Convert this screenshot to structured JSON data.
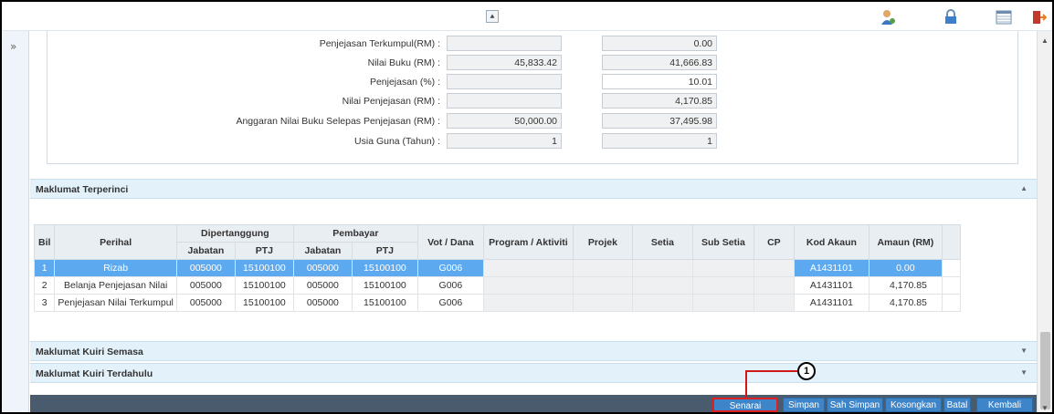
{
  "toolbar_top": {
    "collapse_glyph": "«",
    "icons": [
      "user-settings-icon",
      "lock-icon",
      "table-view-icon",
      "exit-door-icon"
    ]
  },
  "form": {
    "rows": [
      {
        "label": "Penjejasan Terkumpul(RM) :",
        "value_a": "",
        "value_b": "0.00"
      },
      {
        "label": "Nilai Buku (RM) :",
        "value_a": "45,833.42",
        "value_b": "41,666.83"
      },
      {
        "label": "Penjejasan (%) :",
        "value_a": "",
        "value_b": "10.01"
      },
      {
        "label": "Nilai Penjejasan (RM) :",
        "value_a": "",
        "value_b": "4,170.85"
      },
      {
        "label": "Anggaran Nilai Buku Selepas Penjejasan (RM) :",
        "value_a": "50,000.00",
        "value_b": "37,495.98"
      },
      {
        "label": "Usia Guna (Tahun) :",
        "value_a": "1",
        "value_b": "1"
      }
    ]
  },
  "sections": {
    "maklumat_terperinci": "Maklumat Terperinci",
    "kuiri_semasa": "Maklumat Kuiri Semasa",
    "kuiri_terdahulu": "Maklumat Kuiri Terdahulu"
  },
  "grid": {
    "headers": {
      "bil": "Bil",
      "perihal": "Perihal",
      "dipertanggung": "Dipertanggung",
      "pembayar": "Pembayar",
      "jabatan": "Jabatan",
      "ptj": "PTJ",
      "vot_dana": "Vot / Dana",
      "program": "Program / Aktiviti",
      "projek": "Projek",
      "setia": "Setia",
      "sub_setia": "Sub Setia",
      "cp": "CP",
      "kod_akaun": "Kod Akaun",
      "amaun": "Amaun (RM)"
    },
    "rows": [
      {
        "bil": "1",
        "perihal": "Rizab",
        "d_jabatan": "005000",
        "d_ptj": "15100100",
        "p_jabatan": "005000",
        "p_ptj": "15100100",
        "vot": "G006",
        "kod": "A1431101",
        "amaun": "0.00",
        "selected": true
      },
      {
        "bil": "2",
        "perihal": "Belanja Penjejasan Nilai",
        "d_jabatan": "005000",
        "d_ptj": "15100100",
        "p_jabatan": "005000",
        "p_ptj": "15100100",
        "vot": "G006",
        "kod": "A1431101",
        "amaun": "4,170.85",
        "selected": false
      },
      {
        "bil": "3",
        "perihal": "Penjejasan Nilai Terkumpul",
        "d_jabatan": "005000",
        "d_ptj": "15100100",
        "p_jabatan": "005000",
        "p_ptj": "15100100",
        "vot": "G006",
        "kod": "A1431101",
        "amaun": "4,170.85",
        "selected": false
      }
    ]
  },
  "buttons": {
    "senarai_semak": "Senarai Semak",
    "simpan": "Simpan",
    "sah_simpan": "Sah Simpan",
    "kosongkan": "Kosongkan",
    "batal": "Batal",
    "kembali": "Kembali"
  },
  "annotation": {
    "number": "1"
  }
}
